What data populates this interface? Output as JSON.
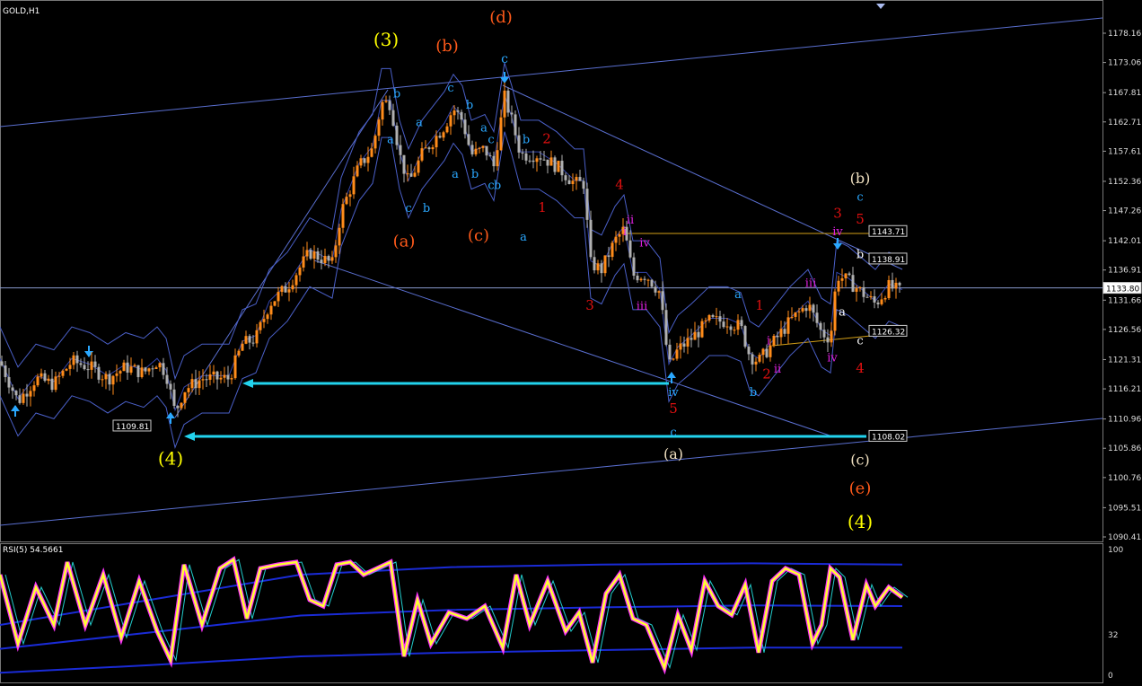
{
  "symbol": "GOLD,H1",
  "rsi_title": "RSI(5) 54.5661",
  "colors": {
    "background": "#000000",
    "bull_candle": "#ff8c1a",
    "bear_candle": "#b0b0b0",
    "bands": "#4a5fc7",
    "channel": "#5a6fd0",
    "horizontal_arrow": "#22d3ee",
    "rsi_main": "#ffff33",
    "rsi_glow": "#ff33ff",
    "rsi_bands": "#1a2bd6"
  },
  "chart_data": [
    {
      "type": "candlestick",
      "title": "GOLD,H1",
      "ylim": [
        1090.41,
        1178.16
      ],
      "y_ticks": [
        "1178.16",
        "1173.06",
        "1167.81",
        "1162.71",
        "1157.61",
        "1152.36",
        "1147.26",
        "1142.01",
        "1136.91",
        "1131.66",
        "1126.56",
        "1121.31",
        "1116.21",
        "1110.96",
        "1105.86",
        "1100.76",
        "1095.51",
        "1090.41"
      ],
      "current_price": "1133.80",
      "price_path": [
        [
          0,
          1121
        ],
        [
          20,
          1114
        ],
        [
          40,
          1118
        ],
        [
          60,
          1117
        ],
        [
          80,
          1121
        ],
        [
          100,
          1120
        ],
        [
          120,
          1118
        ],
        [
          140,
          1120
        ],
        [
          160,
          1119
        ],
        [
          175,
          1121
        ],
        [
          185,
          1119
        ],
        [
          195,
          1112
        ],
        [
          205,
          1116
        ],
        [
          225,
          1118
        ],
        [
          255,
          1118
        ],
        [
          270,
          1124
        ],
        [
          285,
          1125
        ],
        [
          300,
          1131
        ],
        [
          320,
          1134
        ],
        [
          345,
          1140
        ],
        [
          370,
          1138
        ],
        [
          380,
          1147
        ],
        [
          400,
          1155
        ],
        [
          415,
          1158
        ],
        [
          425,
          1166
        ],
        [
          435,
          1166
        ],
        [
          445,
          1157
        ],
        [
          455,
          1152
        ],
        [
          470,
          1157
        ],
        [
          485,
          1160
        ],
        [
          495,
          1162
        ],
        [
          505,
          1165
        ],
        [
          515,
          1163
        ],
        [
          525,
          1157
        ],
        [
          540,
          1158
        ],
        [
          550,
          1155
        ],
        [
          562,
          1167
        ],
        [
          570,
          1163
        ],
        [
          580,
          1157
        ],
        [
          600,
          1157
        ],
        [
          620,
          1155
        ],
        [
          640,
          1152
        ],
        [
          650,
          1152
        ],
        [
          658,
          1138
        ],
        [
          670,
          1137
        ],
        [
          685,
          1142
        ],
        [
          695,
          1144
        ],
        [
          705,
          1136
        ],
        [
          720,
          1136
        ],
        [
          735,
          1133
        ],
        [
          745,
          1120
        ],
        [
          755,
          1123
        ],
        [
          770,
          1125
        ],
        [
          790,
          1128
        ],
        [
          810,
          1128
        ],
        [
          825,
          1127
        ],
        [
          835,
          1122
        ],
        [
          845,
          1121
        ],
        [
          860,
          1124
        ],
        [
          880,
          1128
        ],
        [
          900,
          1131
        ],
        [
          915,
          1126
        ],
        [
          925,
          1125
        ],
        [
          932,
          1136
        ],
        [
          945,
          1135
        ],
        [
          960,
          1133
        ],
        [
          975,
          1131
        ],
        [
          990,
          1134
        ],
        [
          1005,
          1133
        ]
      ],
      "price_labels": [
        {
          "text": "1143.71",
          "y": 1143.71
        },
        {
          "text": "1138.91",
          "y": 1138.91
        },
        {
          "text": "1133.80",
          "y": 1133.8
        },
        {
          "text": "1126.32",
          "y": 1126.32
        },
        {
          "text": "1108.02",
          "y": 1108.02
        },
        {
          "text": "1109.81",
          "y": 1109.81
        }
      ],
      "annotations": [
        {
          "text": "(3)",
          "x": 430,
          "y": 1176,
          "color": "#ffff00",
          "size": 20
        },
        {
          "text": "(b)",
          "x": 498,
          "y": 1175,
          "color": "#ff5a1a",
          "size": 18
        },
        {
          "text": "(d)",
          "x": 558,
          "y": 1180,
          "color": "#ff5a1a",
          "size": 18
        },
        {
          "text": "c",
          "x": 562,
          "y": 1173,
          "color": "#2aa8ff",
          "size": 14
        },
        {
          "text": "b",
          "x": 442,
          "y": 1167,
          "color": "#2aa8ff",
          "size": 13
        },
        {
          "text": "c",
          "x": 502,
          "y": 1168,
          "color": "#2aa8ff",
          "size": 13
        },
        {
          "text": "a",
          "x": 467,
          "y": 1162,
          "color": "#2aa8ff",
          "size": 13
        },
        {
          "text": "b",
          "x": 523,
          "y": 1165,
          "color": "#2aa8ff",
          "size": 13
        },
        {
          "text": "a",
          "x": 435,
          "y": 1159,
          "color": "#2aa8ff",
          "size": 13
        },
        {
          "text": "a",
          "x": 539,
          "y": 1161,
          "color": "#2aa8ff",
          "size": 13
        },
        {
          "text": "c",
          "x": 547,
          "y": 1159,
          "color": "#2aa8ff",
          "size": 13
        },
        {
          "text": "b",
          "x": 586,
          "y": 1159,
          "color": "#2aa8ff",
          "size": 13
        },
        {
          "text": "2",
          "x": 609,
          "y": 1159,
          "color": "#e01010",
          "size": 15
        },
        {
          "text": "a",
          "x": 507,
          "y": 1153,
          "color": "#2aa8ff",
          "size": 13
        },
        {
          "text": "b",
          "x": 529,
          "y": 1153,
          "color": "#2aa8ff",
          "size": 13
        },
        {
          "text": "c",
          "x": 547,
          "y": 1151,
          "color": "#2aa8ff",
          "size": 13
        },
        {
          "text": "b",
          "x": 554,
          "y": 1151,
          "color": "#2aa8ff",
          "size": 13
        },
        {
          "text": "4",
          "x": 690,
          "y": 1151,
          "color": "#e01010",
          "size": 15
        },
        {
          "text": "c",
          "x": 455,
          "y": 1147,
          "color": "#2aa8ff",
          "size": 13
        },
        {
          "text": "b",
          "x": 475,
          "y": 1147,
          "color": "#2aa8ff",
          "size": 13
        },
        {
          "text": "1",
          "x": 604,
          "y": 1147,
          "color": "#e01010",
          "size": 15
        },
        {
          "text": "ii",
          "x": 702,
          "y": 1145,
          "color": "#e020e0",
          "size": 13
        },
        {
          "text": "i",
          "x": 696,
          "y": 1143,
          "color": "#e020e0",
          "size": 13
        },
        {
          "text": "iv",
          "x": 718,
          "y": 1141,
          "color": "#e020e0",
          "size": 13
        },
        {
          "text": "(a)",
          "x": 450,
          "y": 1141,
          "color": "#ff5a1a",
          "size": 18
        },
        {
          "text": "(c)",
          "x": 533,
          "y": 1142,
          "color": "#ff5a1a",
          "size": 18
        },
        {
          "text": "a",
          "x": 583,
          "y": 1142,
          "color": "#2aa8ff",
          "size": 13
        },
        {
          "text": "3",
          "x": 657,
          "y": 1130,
          "color": "#e01010",
          "size": 15
        },
        {
          "text": "iii",
          "x": 715,
          "y": 1130,
          "color": "#e020e0",
          "size": 13
        },
        {
          "text": "a",
          "x": 822,
          "y": 1132,
          "color": "#2aa8ff",
          "size": 13
        },
        {
          "text": "1",
          "x": 846,
          "y": 1130,
          "color": "#e01010",
          "size": 15
        },
        {
          "text": "i",
          "x": 856,
          "y": 1124,
          "color": "#e020e0",
          "size": 13
        },
        {
          "text": "iii",
          "x": 903,
          "y": 1134,
          "color": "#e020e0",
          "size": 13
        },
        {
          "text": "ii",
          "x": 866,
          "y": 1119,
          "color": "#e020e0",
          "size": 13
        },
        {
          "text": "2",
          "x": 854,
          "y": 1118,
          "color": "#e01010",
          "size": 15
        },
        {
          "text": "b",
          "x": 839,
          "y": 1115,
          "color": "#2aa8ff",
          "size": 13
        },
        {
          "text": "iv",
          "x": 750,
          "y": 1115,
          "color": "#2aa8ff",
          "size": 13
        },
        {
          "text": "5",
          "x": 750,
          "y": 1112,
          "color": "#e01010",
          "size": 15
        },
        {
          "text": "c",
          "x": 750,
          "y": 1108,
          "color": "#2aa8ff",
          "size": 13
        },
        {
          "text": "(a)",
          "x": 750,
          "y": 1104,
          "color": "#f0e0c0",
          "size": 16
        },
        {
          "text": "(b)",
          "x": 958,
          "y": 1152,
          "color": "#f0e0c0",
          "size": 16
        },
        {
          "text": "c",
          "x": 958,
          "y": 1149,
          "color": "#2aa8ff",
          "size": 13
        },
        {
          "text": "3",
          "x": 933,
          "y": 1146,
          "color": "#e01010",
          "size": 15
        },
        {
          "text": "5",
          "x": 958,
          "y": 1145,
          "color": "#e01010",
          "size": 15
        },
        {
          "text": "iv",
          "x": 933,
          "y": 1143,
          "color": "#e020e0",
          "size": 13
        },
        {
          "text": "b",
          "x": 958,
          "y": 1139,
          "color": "#ffffff",
          "size": 13
        },
        {
          "text": "a",
          "x": 938,
          "y": 1129,
          "color": "#ffffff",
          "size": 13
        },
        {
          "text": "c",
          "x": 958,
          "y": 1124,
          "color": "#ffffff",
          "size": 13
        },
        {
          "text": "iv",
          "x": 927,
          "y": 1121,
          "color": "#e020e0",
          "size": 13
        },
        {
          "text": "4",
          "x": 958,
          "y": 1119,
          "color": "#e01010",
          "size": 15
        },
        {
          "text": "(c)",
          "x": 958,
          "y": 1103,
          "color": "#f0e0c0",
          "size": 16
        },
        {
          "text": "(e)",
          "x": 958,
          "y": 1098,
          "color": "#ff5a1a",
          "size": 18
        },
        {
          "text": "(4)",
          "x": 958,
          "y": 1092,
          "color": "#ffff00",
          "size": 20
        },
        {
          "text": "(4)",
          "x": 190,
          "y": 1103,
          "color": "#ffff00",
          "size": 20
        }
      ]
    },
    {
      "type": "line",
      "title": "RSI(5) 54.5661",
      "ylim": [
        0,
        100
      ],
      "y_ticks": [
        "100",
        "32",
        "0"
      ],
      "x": [
        0,
        20,
        40,
        60,
        75,
        95,
        115,
        135,
        155,
        175,
        190,
        205,
        225,
        245,
        260,
        275,
        290,
        310,
        330,
        345,
        360,
        375,
        390,
        405,
        420,
        435,
        450,
        465,
        480,
        500,
        520,
        540,
        560,
        575,
        590,
        610,
        630,
        645,
        660,
        675,
        690,
        705,
        720,
        740,
        755,
        770,
        785,
        800,
        815,
        830,
        845,
        860,
        875,
        890,
        905,
        915,
        925,
        935,
        950,
        965,
        975,
        990,
        1005
      ],
      "values": [
        80,
        25,
        70,
        40,
        90,
        40,
        80,
        30,
        75,
        35,
        12,
        88,
        40,
        85,
        92,
        45,
        85,
        88,
        90,
        60,
        55,
        88,
        90,
        80,
        85,
        90,
        15,
        60,
        25,
        50,
        45,
        55,
        22,
        80,
        40,
        75,
        35,
        50,
        10,
        65,
        80,
        45,
        40,
        6,
        48,
        20,
        75,
        55,
        48,
        72,
        18,
        75,
        85,
        80,
        25,
        40,
        85,
        78,
        28,
        72,
        55,
        70,
        62
      ],
      "bands": {
        "upper": [
          40,
          60,
          80,
          86,
          88,
          89,
          88
        ],
        "lower": [
          2,
          8,
          15,
          18,
          20,
          22,
          22
        ]
      }
    }
  ]
}
